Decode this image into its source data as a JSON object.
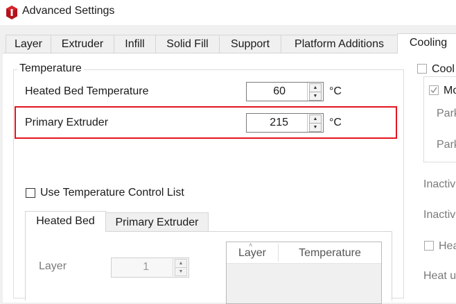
{
  "window": {
    "title": "Advanced Settings",
    "icon": "app-logo-icon"
  },
  "tabs": [
    {
      "label": "Layer"
    },
    {
      "label": "Extruder"
    },
    {
      "label": "Infill"
    },
    {
      "label": "Solid Fill"
    },
    {
      "label": "Support"
    },
    {
      "label": "Platform Additions"
    },
    {
      "label": "Cooling"
    }
  ],
  "temperature": {
    "group_title": "Temperature",
    "heated_bed": {
      "label": "Heated Bed Temperature",
      "value": "60",
      "unit": "°C"
    },
    "primary_extruder": {
      "label": "Primary Extruder",
      "value": "215",
      "unit": "°C"
    },
    "use_control_list": {
      "label": "Use Temperature Control List",
      "checked": false
    },
    "inner_tabs": [
      {
        "label": "Heated Bed"
      },
      {
        "label": "Primary Extruder"
      }
    ],
    "layer": {
      "label": "Layer",
      "value": "1"
    },
    "list_columns": {
      "layer": "Layer",
      "temperature": "Temperature"
    }
  },
  "right_panel": {
    "cool_label": "Cool",
    "mo_label": "Mo",
    "park1": "Park",
    "park2": "Park",
    "inactive1": "Inactiv",
    "inactive2": "Inactiv",
    "hea_label": "Hea",
    "heat_u": "Heat u"
  },
  "colors": {
    "highlight": "#e3141f",
    "background": "#f0f0f0"
  }
}
